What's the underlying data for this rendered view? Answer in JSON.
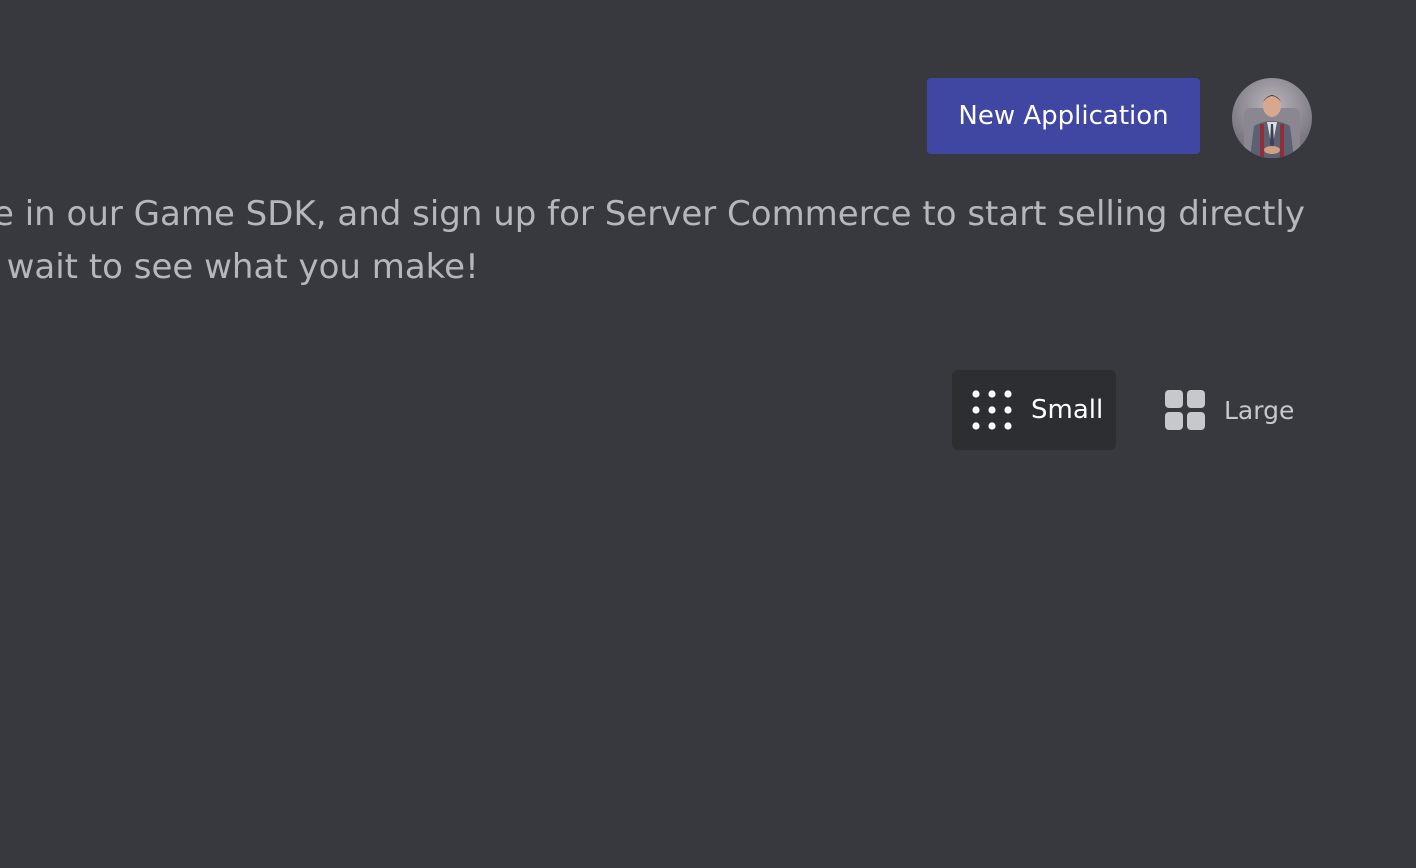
{
  "header": {
    "new_application_label": "New Application",
    "avatar_icon": "user-avatar"
  },
  "intro": {
    "line1": "ne in our Game SDK, and sign up for Server Commerce to start selling directly",
    "line2": "new application. We can't wait to see what you make!"
  },
  "view_toggle": {
    "small_label": "Small",
    "small_icon": "small-grid-icon",
    "large_label": "Large",
    "large_icon": "large-grid-icon",
    "selected": "Small"
  },
  "colors": {
    "background": "#38393e",
    "accent": "#3f47a3",
    "text_muted": "#b5b7bc",
    "active_bg": "#2d2e32"
  }
}
